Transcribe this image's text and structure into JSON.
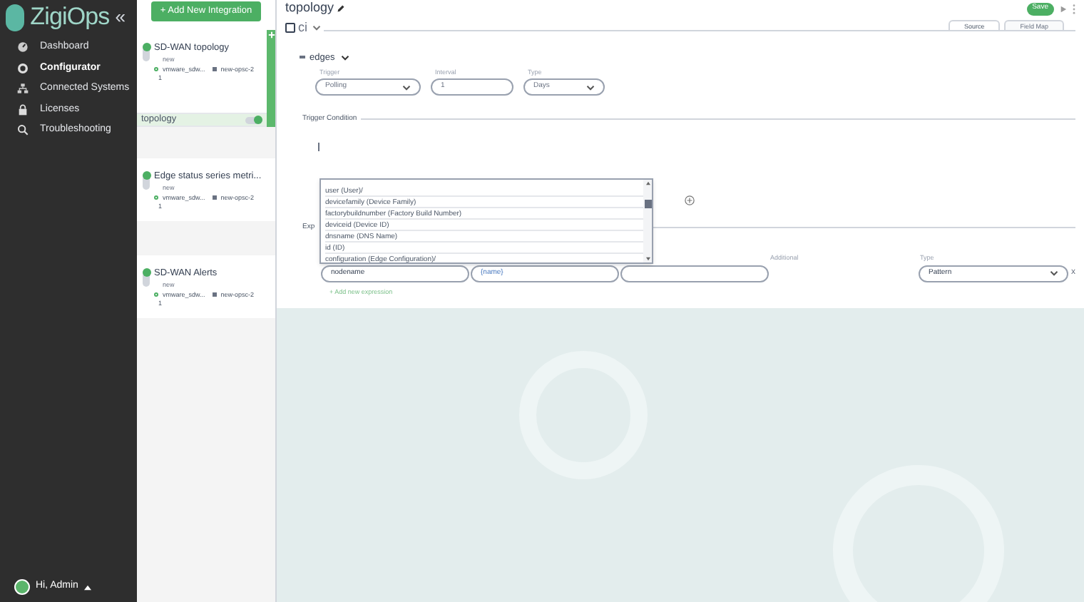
{
  "sidebar": {
    "logo": "ZigiOps",
    "collapse": "«",
    "items": [
      {
        "label": "Dashboard",
        "selected": false
      },
      {
        "label": "Configurator",
        "selected": true
      },
      {
        "label": "Connected Systems",
        "selected": false
      },
      {
        "label": "Licenses",
        "selected": false
      },
      {
        "label": "Troubleshooting",
        "selected": false
      }
    ],
    "user": "Hi, Admin"
  },
  "integrations": {
    "add_button": "+ Add New Integration",
    "items": [
      {
        "name": "SD-WAN topology",
        "status": "new",
        "source": "vmware_sdw...",
        "target": "new-opsc-2",
        "count": "1",
        "selected": true,
        "children": [
          {
            "label": "topology",
            "on": true
          }
        ]
      },
      {
        "name": "Edge status series metri...",
        "status": "new",
        "source": "vmware_sdw...",
        "target": "new-opsc-2",
        "count": "1",
        "selected": false
      },
      {
        "name": "SD-WAN Alerts",
        "status": "new",
        "source": "vmware_sdw...",
        "target": "new-opsc-2",
        "count": "1",
        "selected": false
      }
    ]
  },
  "editor": {
    "title": "topology",
    "save": "Save",
    "tabs": [
      {
        "label": "Source",
        "selected": true
      },
      {
        "label": "Field Map",
        "selected": false
      }
    ],
    "entity": "ci",
    "subentity": "edges",
    "trigger": {
      "fields": [
        {
          "label": "Trigger",
          "value": "Polling",
          "kind": "select"
        },
        {
          "label": "Interval",
          "value": "1",
          "kind": "input"
        },
        {
          "label": "Type",
          "value": "Days",
          "kind": "select"
        }
      ]
    },
    "trigger_condition": "Trigger Condition",
    "dropdown": [
      "user (User)/",
      "devicefamily (Device Family)",
      "factorybuildnumber (Factory Build Number)",
      "deviceid (Device ID)",
      "dnsname (DNS Name)",
      "id (ID)",
      "configuration (Edge Configuration)/"
    ],
    "expressions_label": "Exp",
    "expression": {
      "field": "nodename",
      "value": "{name}",
      "additional_label": "Additional",
      "type_label": "Type",
      "type": "Pattern",
      "remove": "x"
    },
    "add_expression": "+ Add new expression"
  }
}
